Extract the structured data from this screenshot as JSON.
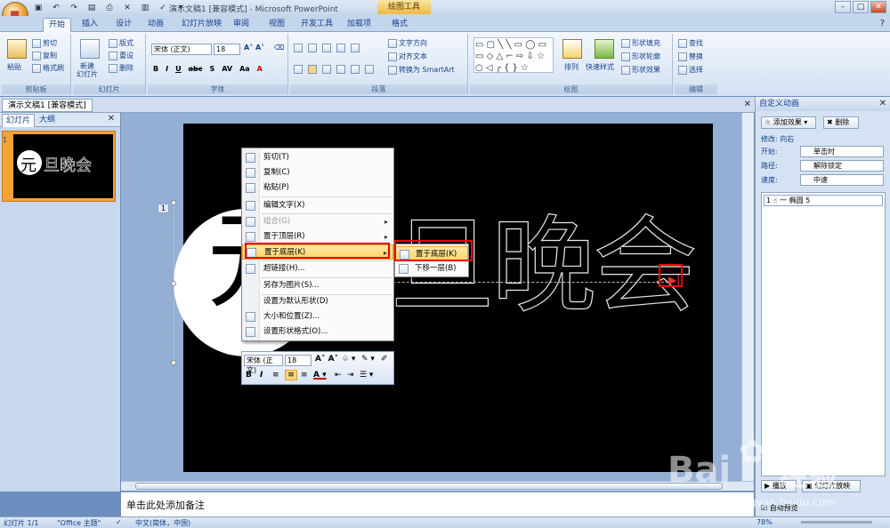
{
  "window": {
    "title": "演示文稿1 [兼容模式] - Microsoft PowerPoint",
    "contextual_tab": "绘图工具"
  },
  "ribbon_tabs": [
    "开始",
    "插入",
    "设计",
    "动画",
    "幻灯片放映",
    "审阅",
    "视图",
    "开发工具",
    "加载项",
    "格式"
  ],
  "ribbon": {
    "clipboard": {
      "label": "剪贴板",
      "paste": "粘贴",
      "cut": "剪切",
      "copy": "复制",
      "format_painter": "格式刷"
    },
    "slides": {
      "label": "幻灯片",
      "new_slide": "新建\n幻灯片",
      "layout": "版式",
      "reset": "重设",
      "delete": "删除"
    },
    "font": {
      "label": "字体",
      "font_name": "宋体 (正文)",
      "font_size": "18"
    },
    "paragraph": {
      "label": "段落",
      "text_direction": "文字方向",
      "align_text": "对齐文本",
      "convert_smartart": "转换为 SmartArt"
    },
    "drawing": {
      "label": "绘图",
      "arrange": "排列",
      "quick_styles": "快速样式",
      "shape_fill": "形状填充",
      "shape_outline": "形状轮廓",
      "shape_effects": "形状效果"
    },
    "editing": {
      "label": "编辑",
      "find": "查找",
      "replace": "替换",
      "select": "选择"
    }
  },
  "doc_tab": "演示文稿1 [兼容模式]",
  "left_pane": {
    "tab_slides": "幻灯片",
    "tab_outline": "大纲",
    "slide_number": "1",
    "thumb_circle": "元",
    "thumb_text": "旦晚会"
  },
  "slide": {
    "circle_char": "元",
    "title_text": "旦晚会",
    "anim_tag": "1"
  },
  "context_menu": {
    "items": [
      {
        "label": "剪切(T)",
        "disabled": false
      },
      {
        "label": "复制(C)",
        "disabled": false
      },
      {
        "label": "粘贴(P)",
        "disabled": false
      },
      {
        "label": "编辑文字(X)",
        "disabled": false
      },
      {
        "label": "组合(G)",
        "disabled": true
      },
      {
        "label": "置于顶层(R)",
        "disabled": false
      },
      {
        "label": "置于底层(K)",
        "disabled": false
      },
      {
        "label": "超链接(H)...",
        "disabled": false
      },
      {
        "label": "另存为图片(S)...",
        "disabled": false
      },
      {
        "label": "设置为默认形状(D)",
        "disabled": false
      },
      {
        "label": "大小和位置(Z)...",
        "disabled": false
      },
      {
        "label": "设置形状格式(O)...",
        "disabled": false
      }
    ],
    "submenu": [
      "置于底层(K)",
      "下移一层(B)"
    ]
  },
  "mini_toolbar": {
    "font": "宋体 (正文)",
    "size": "18"
  },
  "notes_placeholder": "单击此处添加备注",
  "right_pane": {
    "title": "自定义动画",
    "add_effect": "添加效果",
    "remove": "删除",
    "modify": "修改: 向右",
    "start_label": "开始:",
    "start_value": "单击时",
    "path_label": "路径:",
    "path_value": "解除锁定",
    "speed_label": "速度:",
    "speed_value": "中速",
    "list_item": "1 ☝ 一 椭圆 5",
    "play": "播放",
    "slideshow": "幻灯片放映",
    "autopreview": "自动预览"
  },
  "status": {
    "slide": "幻灯片 1/1",
    "theme": "\"Office 主题\"",
    "lang": "中文(简体，中国)",
    "zoom": "78%"
  },
  "watermark": {
    "brand": "Bai",
    "brand2": "经验",
    "url": "jingyan.baidu.com"
  }
}
